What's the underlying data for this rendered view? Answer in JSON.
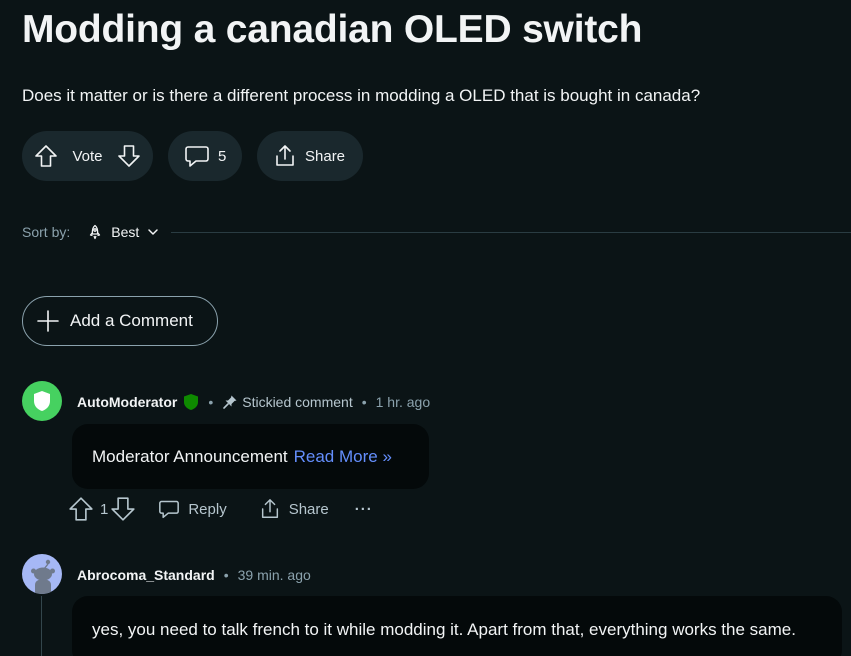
{
  "post": {
    "title": "Modding a canadian OLED switch",
    "body": "Does it matter or is there a different process in modding a OLED that is bought in canada?",
    "vote_label": "Vote",
    "comment_count": "5",
    "share_label": "Share"
  },
  "sort": {
    "label": "Sort by:",
    "value": "Best"
  },
  "add_comment_label": "Add a Comment",
  "comments": [
    {
      "author": "AutoModerator",
      "stickied_label": "Stickied comment",
      "time": "1 hr. ago",
      "text": "Moderator Announcement",
      "link": "Read More »",
      "votes": "1",
      "reply_label": "Reply",
      "share_label": "Share",
      "more_label": "···"
    },
    {
      "author": "Abrocoma_Standard",
      "time": "39 min. ago",
      "text": "yes, you need to talk french to it while modding it. Apart from that, everything works the same."
    }
  ],
  "colors": {
    "background": "#0b1416",
    "pill": "#1a282d",
    "bubble": "#04090a",
    "link": "#648efc",
    "mod_green": "#46d160",
    "user_avatar": "#a6b8f5"
  }
}
